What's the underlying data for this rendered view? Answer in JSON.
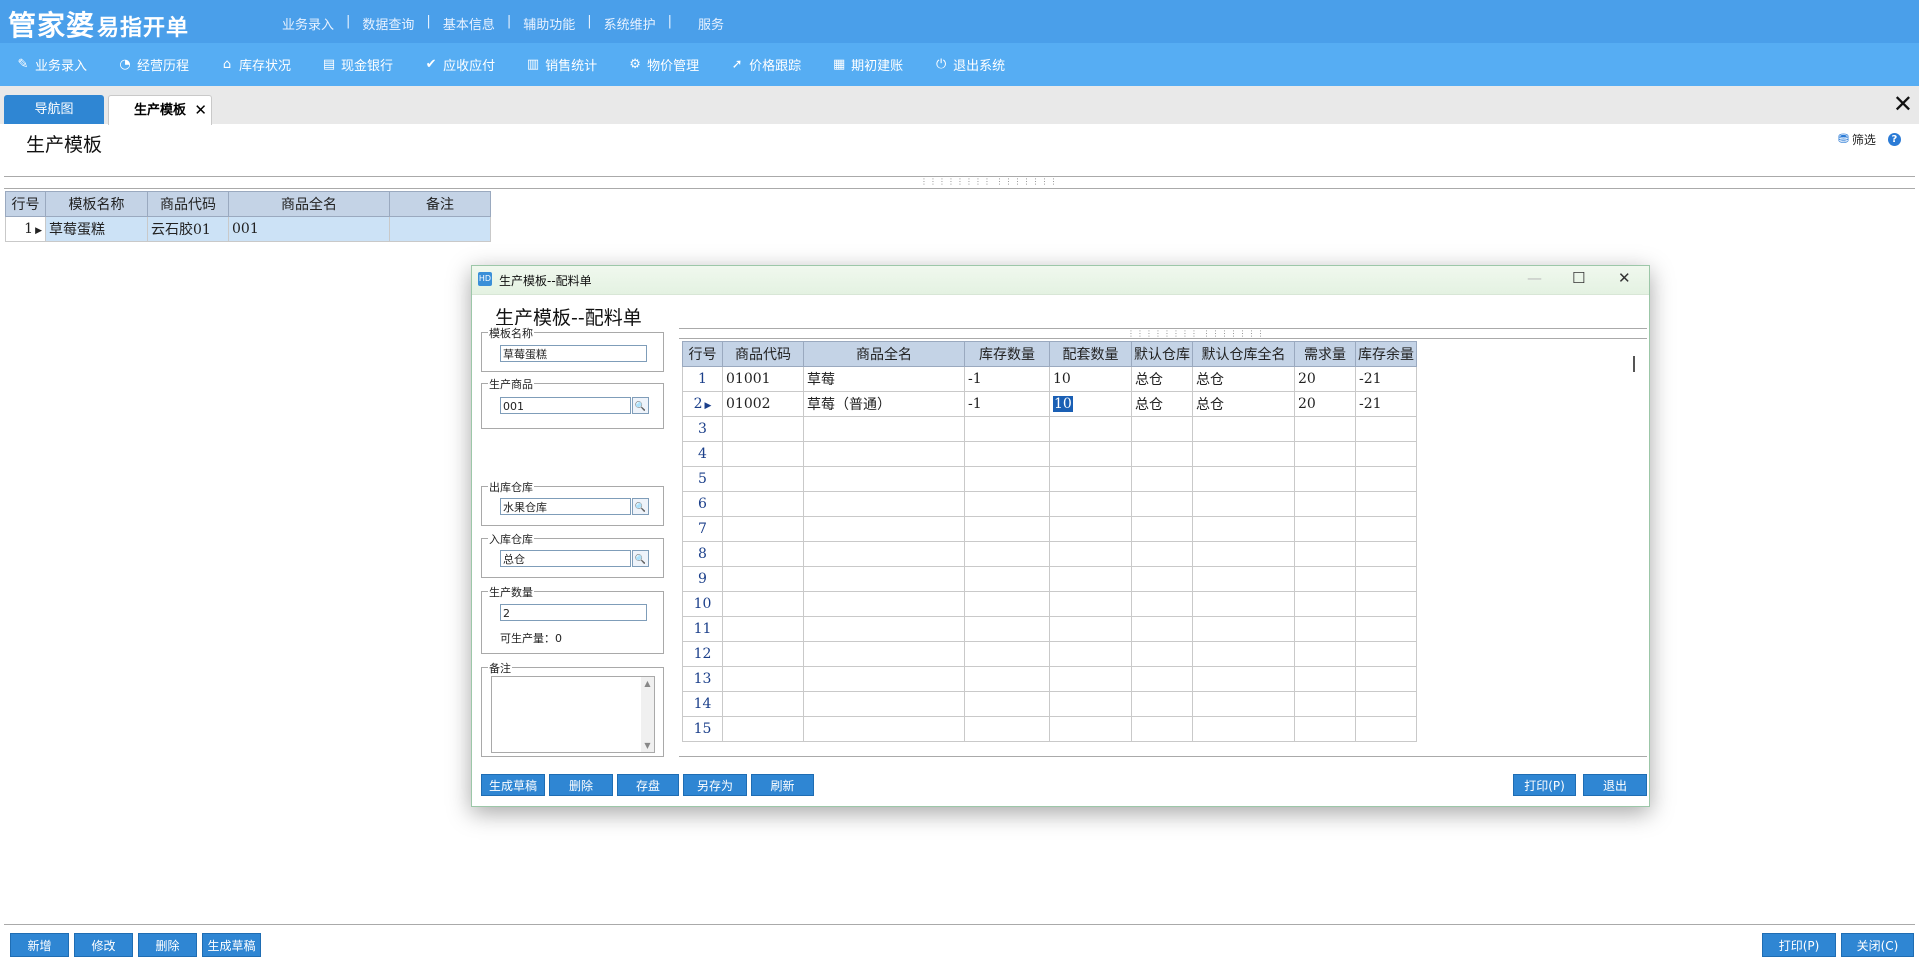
{
  "app": {
    "logo_main": "管家婆",
    "logo_sub": "易指开单",
    "top_nav": [
      "业务录入",
      "数据查询",
      "基本信息",
      "辅助功能",
      "系统维护",
      "服务"
    ]
  },
  "toolbar": [
    {
      "label": "业务录入",
      "icon": "pen-icon",
      "glyph": "✎"
    },
    {
      "label": "经营历程",
      "icon": "pie-chart-icon",
      "glyph": "◔"
    },
    {
      "label": "库存状况",
      "icon": "home-icon",
      "glyph": "⌂"
    },
    {
      "label": "现金银行",
      "icon": "book-icon",
      "glyph": "▤"
    },
    {
      "label": "应收应付",
      "icon": "check-circle-icon",
      "glyph": "✔"
    },
    {
      "label": "销售统计",
      "icon": "bar-chart-icon",
      "glyph": "▥"
    },
    {
      "label": "物价管理",
      "icon": "gear-icon",
      "glyph": "⚙"
    },
    {
      "label": "价格跟踪",
      "icon": "arrow-icon",
      "glyph": "➚"
    },
    {
      "label": "期初建账",
      "icon": "calculator-icon",
      "glyph": "▦"
    },
    {
      "label": "退出系统",
      "icon": "power-icon",
      "glyph": "⏻"
    }
  ],
  "tabs": {
    "nav_label": "导航图",
    "active_label": "生产模板",
    "close_glyph": "✕",
    "close_all_glyph": "✕"
  },
  "page": {
    "title": "生产模板",
    "filter_label": "筛选",
    "help_glyph": "?",
    "splitter_grip": "⋮⋮⋮⋮⋮⋮⋮⋮ ⋮⋮⋮⋮⋮⋮⋮"
  },
  "main_grid": {
    "headers": [
      "行号",
      "模板名称",
      "商品代码",
      "商品全名",
      "备注"
    ],
    "rows": [
      {
        "no": "1",
        "name": "草莓蛋糕",
        "code": "云石胶01",
        "full_name": "001",
        "note": ""
      }
    ]
  },
  "bottom_buttons": [
    "新增",
    "修改",
    "删除",
    "生成草稿"
  ],
  "bottom_right_buttons": [
    "打印(P)",
    "关闭(C)"
  ],
  "dialog": {
    "title": "生产模板--配料单",
    "icon_text": "HD",
    "heading": "生产模板--配料单",
    "window_buttons": {
      "minimize": "—",
      "maximize": "☐",
      "close": "✕"
    },
    "template_name_label": "模板名称",
    "template_name_value": "草莓蛋糕",
    "product_label": "生产商品",
    "product_value": "001",
    "out_warehouse_label": "出库仓库",
    "out_warehouse_value": "水果仓库",
    "in_warehouse_label": "入库仓库",
    "in_warehouse_value": "总仓",
    "qty_label": "生产数量",
    "qty_value": "2",
    "producible_label": "可生产量：",
    "producible_value": "0",
    "note_label": "备注",
    "lookup_glyph": "🔍",
    "grid": {
      "headers": [
        "行号",
        "商品代码",
        "商品全名",
        "库存数量",
        "配套数量",
        "默认仓库",
        "默认仓库全名",
        "需求量",
        "库存余量"
      ],
      "rows": [
        {
          "no": "1",
          "code": "01001",
          "name": "草莓",
          "stock": "-1",
          "set_qty": "10",
          "wh": "总仓",
          "wh_full": "总仓",
          "need": "20",
          "remain": "-21"
        },
        {
          "no": "2",
          "code": "01002",
          "name": "草莓（普通）",
          "stock": "-1",
          "set_qty": "10",
          "wh": "总仓",
          "wh_full": "总仓",
          "need": "20",
          "remain": "-21"
        },
        {
          "no": "3"
        },
        {
          "no": "4"
        },
        {
          "no": "5"
        },
        {
          "no": "6"
        },
        {
          "no": "7"
        },
        {
          "no": "8"
        },
        {
          "no": "9"
        },
        {
          "no": "10"
        },
        {
          "no": "11"
        },
        {
          "no": "12"
        },
        {
          "no": "13"
        },
        {
          "no": "14"
        },
        {
          "no": "15"
        }
      ]
    },
    "buttons_left": [
      "生成草稿",
      "删除",
      "存盘",
      "另存为",
      "刷新"
    ],
    "buttons_right": [
      "打印(P)",
      "退出"
    ]
  }
}
